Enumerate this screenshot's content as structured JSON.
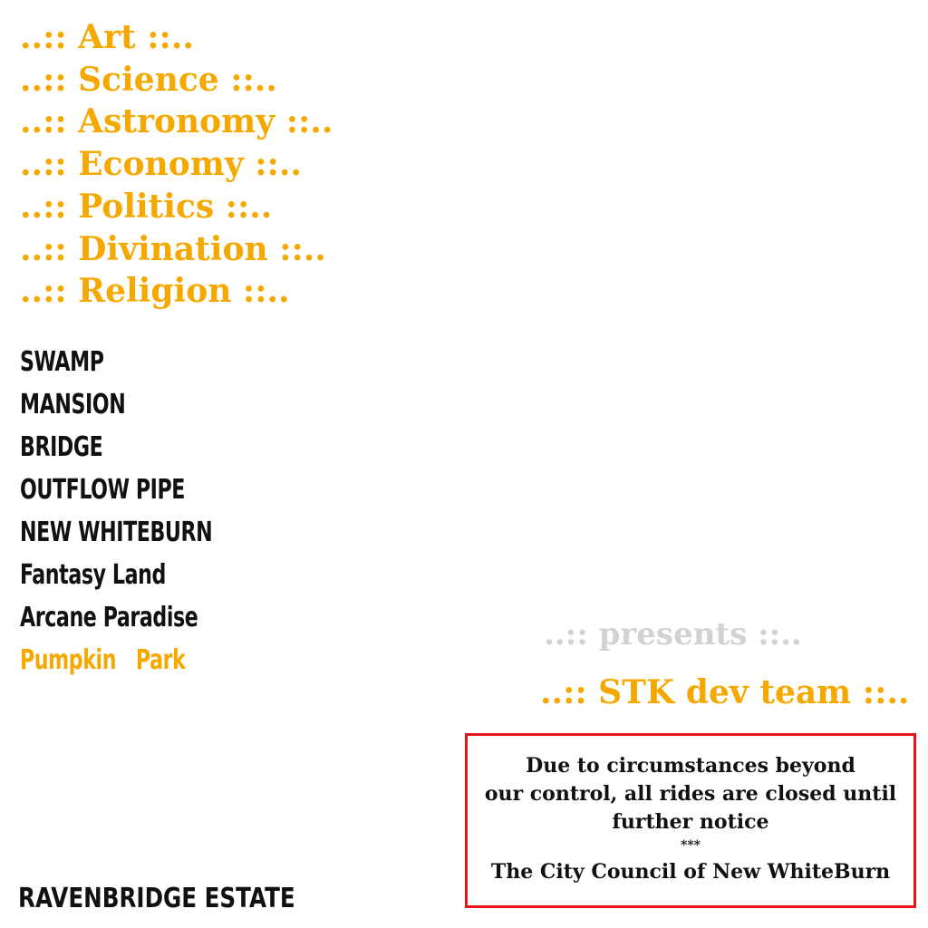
{
  "menu": {
    "items": [
      "..:: Art ::..",
      "..:: Science ::..",
      "..:: Astronomy ::..",
      "..:: Economy ::..",
      "..:: Politics ::..",
      "..:: Divination ::..",
      "..:: Religion ::.."
    ]
  },
  "levels": {
    "items": [
      "SWAMP",
      "MANSION",
      "BRIDGE",
      "OUTFLOW PIPE",
      "NEW WHITEBURN",
      "Fantasy Land",
      "Arcane Paradise",
      "Pumpkin   Park"
    ],
    "selected_index": 7
  },
  "credits": {
    "presents": "..:: presents ::..",
    "team": "..:: STK dev team ::.."
  },
  "notice": {
    "line1": "Due to circumstances beyond",
    "line2": "our control, all rides are closed until",
    "line3": "further notice",
    "stars": "***",
    "signature": "The City Council of New WhiteBurn"
  },
  "footer": {
    "estate": "RAVENBRIDGE ESTATE"
  },
  "colors": {
    "accent": "#f5a800",
    "text": "#111111",
    "muted": "#d2d2d2",
    "border": "#e8141c",
    "background": "#ffffff"
  }
}
